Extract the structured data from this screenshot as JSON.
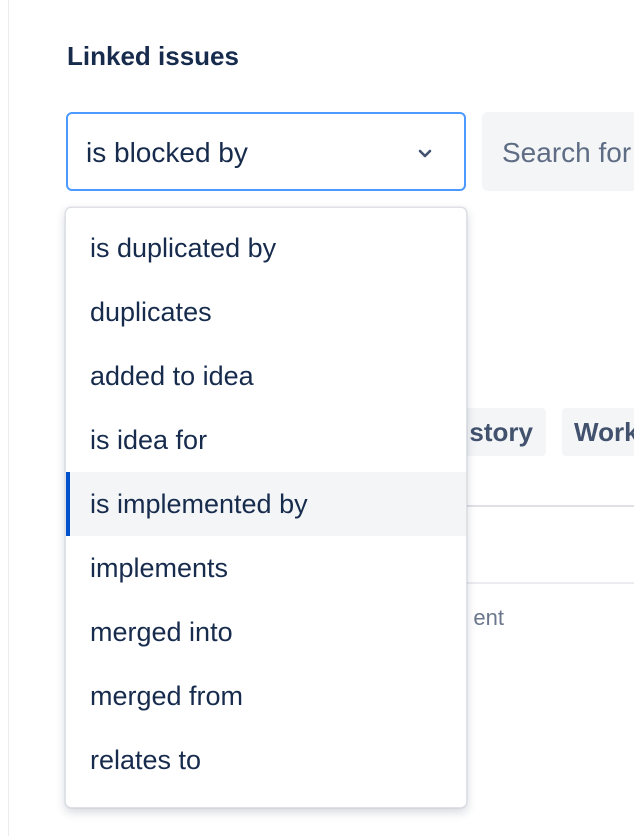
{
  "section": {
    "title": "Linked issues"
  },
  "link_type_select": {
    "selected_value": "is blocked by",
    "icon": "chevron-down-icon",
    "focus_border_color": "#4c9aff"
  },
  "search": {
    "placeholder": "Search for"
  },
  "background": {
    "chip_story_label": "story",
    "chip_work_label": "Work",
    "partial_text": "ent"
  },
  "dropdown": {
    "active_index": 4,
    "active_indicator_color": "#0052cc",
    "options": [
      "is duplicated by",
      "duplicates",
      "added to idea",
      "is idea for",
      "is implemented by",
      "implements",
      "merged into",
      "merged from",
      "relates to"
    ]
  }
}
